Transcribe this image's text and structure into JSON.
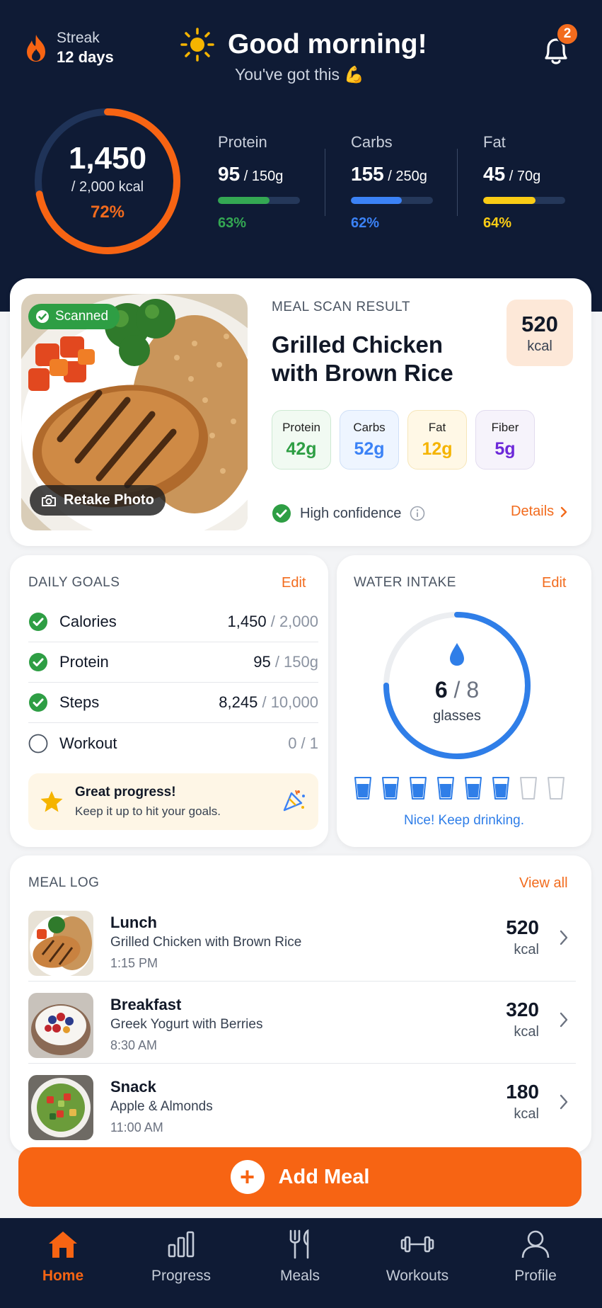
{
  "header": {
    "streak_label": "Streak",
    "streak_value": "12 days",
    "greeting": "Good morning!",
    "subtitle": "You've got this 💪",
    "notifications_count": "2"
  },
  "calories": {
    "consumed": "1,450",
    "goal_text": "/ 2,000 kcal",
    "percent_text": "72%",
    "progress": 0.72
  },
  "macros": [
    {
      "name": "Protein",
      "value": "95",
      "total": " / 150g",
      "percent_text": "63%",
      "progress": 0.63,
      "color": "#34a853"
    },
    {
      "name": "Carbs",
      "value": "155",
      "total": " / 250g",
      "percent_text": "62%",
      "progress": 0.62,
      "color": "#3b82f6"
    },
    {
      "name": "Fat",
      "value": "45",
      "total": " / 70g",
      "percent_text": "64%",
      "progress": 0.64,
      "color": "#facc15"
    }
  ],
  "scan": {
    "badge": "Scanned",
    "retake": "Retake Photo",
    "label": "MEAL SCAN RESULT",
    "title": "Grilled Chicken with Brown Rice",
    "kcal": "520",
    "kcal_unit": "kcal",
    "nutrients": [
      {
        "name": "Protein",
        "value": "42g",
        "color": "#2e9e44"
      },
      {
        "name": "Carbs",
        "value": "52g",
        "color": "#3b82f6"
      },
      {
        "name": "Fat",
        "value": "12g",
        "color": "#f5b400"
      },
      {
        "name": "Fiber",
        "value": "5g",
        "color": "#7c3aed"
      }
    ],
    "confidence": "High confidence",
    "details": "Details"
  },
  "goals": {
    "label": "DAILY GOALS",
    "edit": "Edit",
    "items": [
      {
        "name": "Calories",
        "value": "1,450",
        "target": " / 2,000",
        "done": true
      },
      {
        "name": "Protein",
        "value": "95",
        "target": " / 150g",
        "done": true
      },
      {
        "name": "Steps",
        "value": "8,245",
        "target": " / 10,000",
        "done": true
      },
      {
        "name": "Workout",
        "value": "",
        "target": "0 / 1",
        "done": false
      }
    ],
    "tip_title": "Great progress!",
    "tip_text": "Keep it up to hit your goals."
  },
  "water": {
    "label": "WATER INTAKE",
    "edit": "Edit",
    "count": "6",
    "total": " / 8",
    "unit": "glasses",
    "filled": 6,
    "glasses_total": 8,
    "message": "Nice! Keep drinking.",
    "color": "#2f7ee8"
  },
  "meal_log": {
    "label": "MEAL LOG",
    "view_all": "View all",
    "items": [
      {
        "title": "Lunch",
        "desc": "Grilled Chicken with Brown Rice",
        "time": "1:15 PM",
        "kcal": "520",
        "unit": "kcal"
      },
      {
        "title": "Breakfast",
        "desc": "Greek Yogurt with Berries",
        "time": "8:30 AM",
        "kcal": "320",
        "unit": "kcal"
      },
      {
        "title": "Snack",
        "desc": "Apple & Almonds",
        "time": "11:00 AM",
        "kcal": "180",
        "unit": "kcal"
      }
    ]
  },
  "add_meal": "Add Meal",
  "tabs": [
    {
      "label": "Home",
      "icon": "home-icon",
      "active": true
    },
    {
      "label": "Progress",
      "icon": "bar-chart-icon",
      "active": false
    },
    {
      "label": "Meals",
      "icon": "fork-knife-icon",
      "active": false
    },
    {
      "label": "Workouts",
      "icon": "dumbbell-icon",
      "active": false
    },
    {
      "label": "Profile",
      "icon": "user-icon",
      "active": false
    }
  ],
  "colors": {
    "accent": "#f76413",
    "navy": "#0f1b35",
    "success": "#2e9e44",
    "water": "#2f7ee8"
  }
}
